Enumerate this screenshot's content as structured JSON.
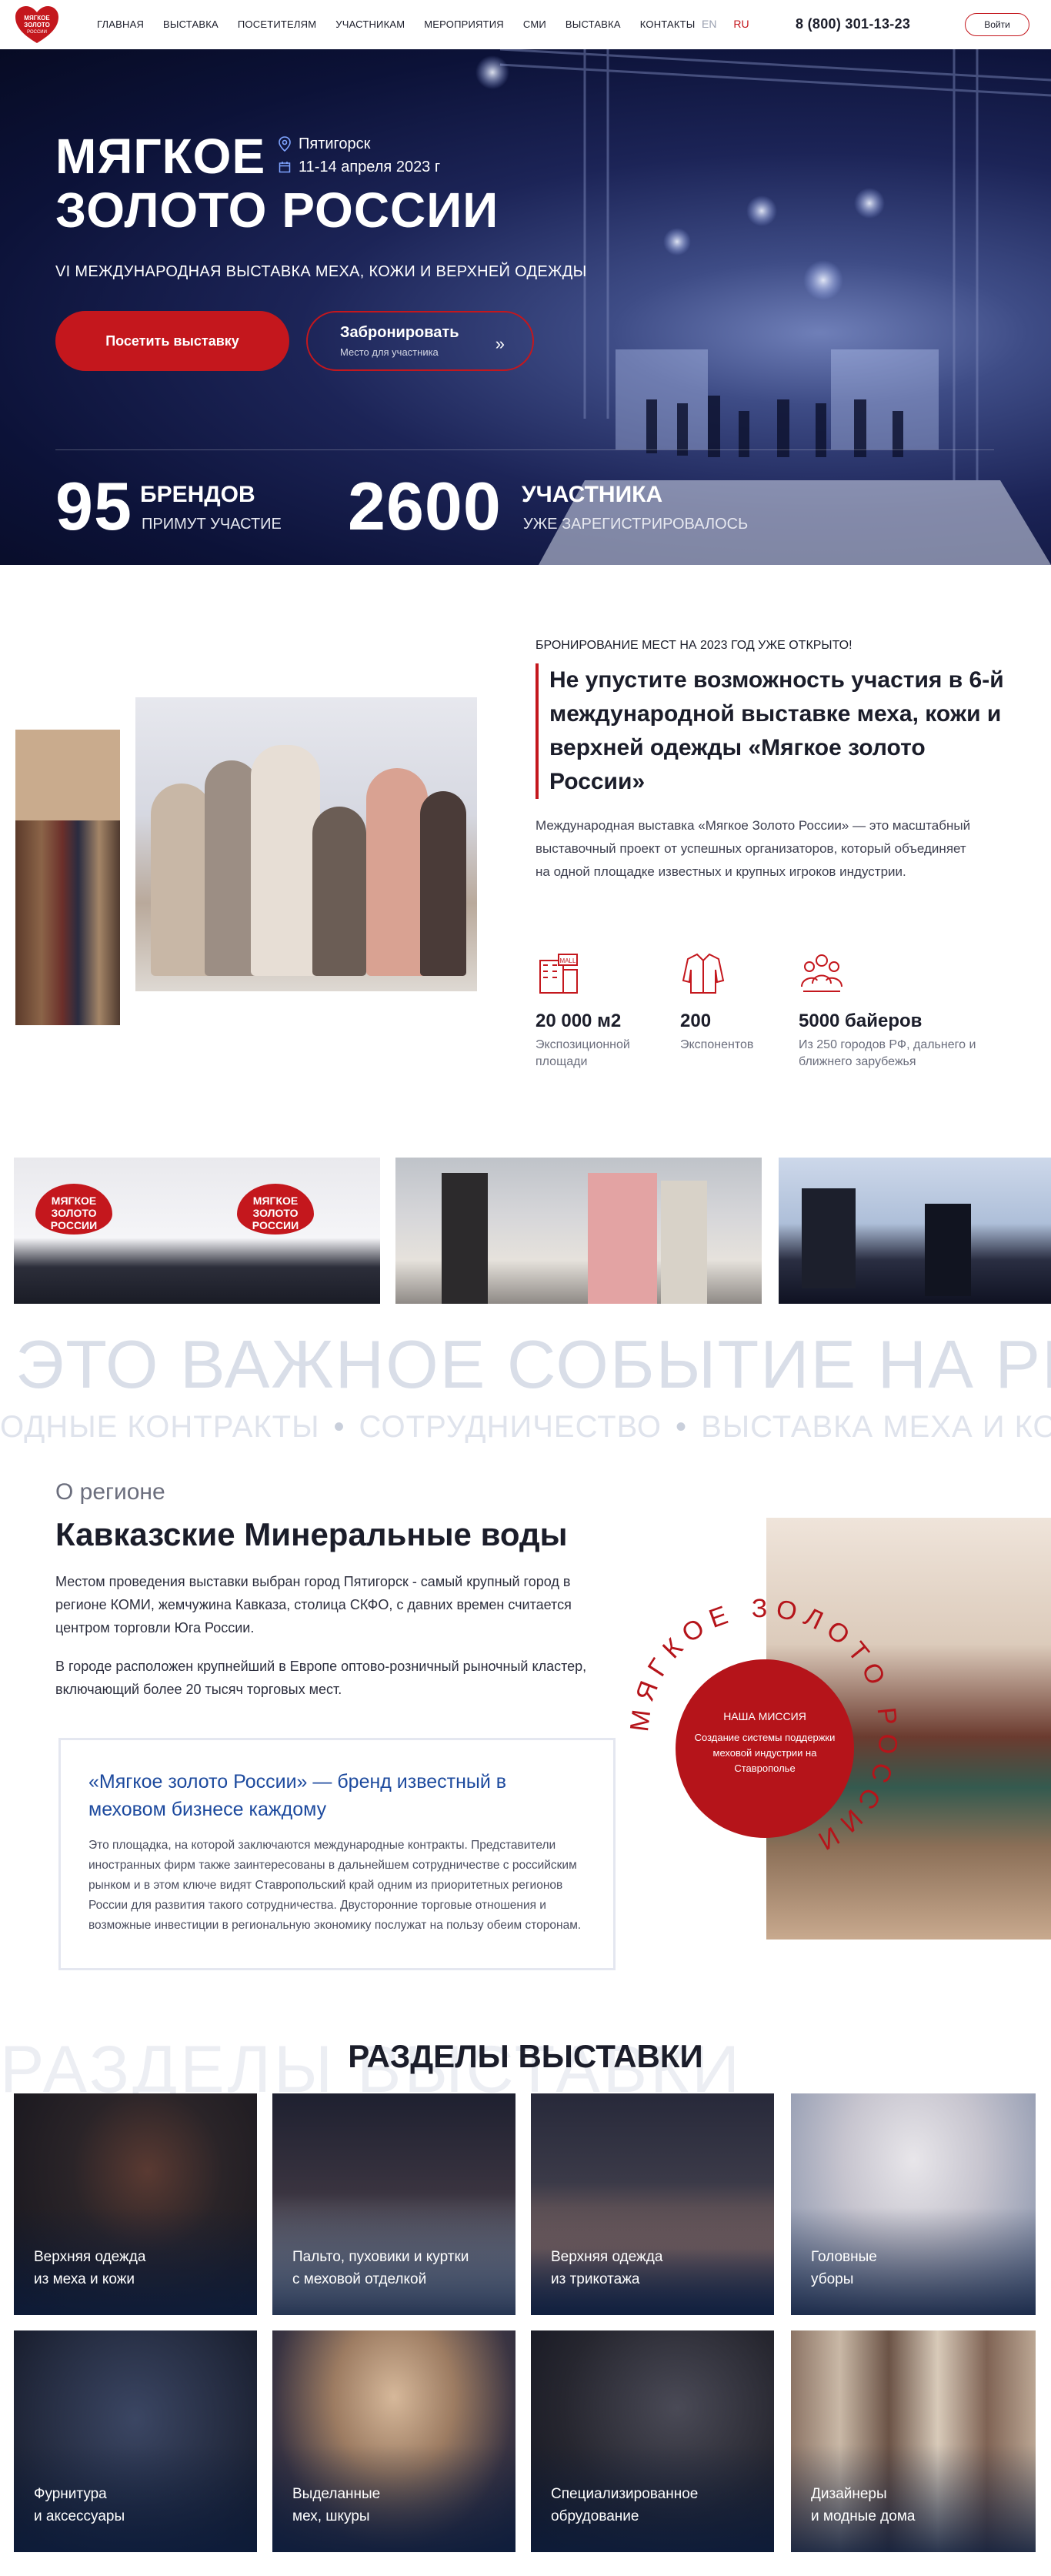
{
  "header": {
    "logo_text": "МЯГКОЕ ЗОЛОТО РОССИИ",
    "nav": [
      "ГЛАВНАЯ",
      "ВЫСТАВКА",
      "ПОСЕТИТЕЛЯМ",
      "УЧАСТНИКАМ",
      "МЕРОПРИЯТИЯ",
      "СМИ",
      "ВЫСТАВКА",
      "КОНТАКТЫ"
    ],
    "lang_en": "EN",
    "lang_ru": "RU",
    "phone": "8 (800) 301-13-23",
    "login": "Войти"
  },
  "hero": {
    "title_line1": "МЯГКОЕ",
    "title_line2": "ЗОЛОТО РОССИИ",
    "city": "Пятигорск",
    "dates": "11-14 апреля 2023 г",
    "subtitle": "VI МЕЖДУНАРОДНАЯ ВЫСТАВКА МЕХА, КОЖИ И ВЕРХНЕЙ ОДЕЖДЫ",
    "btn_visit": "Посетить выставку",
    "btn_book_title": "Забронировать",
    "btn_book_sub": "Место для участника",
    "stat1_num": "95",
    "stat1_l1": "БРЕНДОВ",
    "stat1_l2": "ПРИМУТ УЧАСТИЕ",
    "stat2_num": "2600",
    "stat2_l1": "УЧАСТНИКА",
    "stat2_l2": "УЖЕ ЗАРЕГИСТРИРОВАЛОСЬ"
  },
  "about": {
    "kicker": "БРОНИРОВАНИЕ МЕСТ НА 2023 ГОД УЖЕ ОТКРЫТО!",
    "title": "Не упустите возможность участия в 6-й международной выставке меха, кожи и верхней одежды «Мягкое золото России»",
    "text": "Международная выставка «Мягкое Золото России» — это масштабный выставочный проект от успешных организаторов, который объединяет на одной площадке известных и крупных игроков индустрии.",
    "features": [
      {
        "big": "20 000 м2",
        "small": "Экспозиционной площади",
        "icon": "mall-icon"
      },
      {
        "big": "200",
        "small": "Экспонентов",
        "icon": "coat-icon"
      },
      {
        "big": "5000 байеров",
        "small": "Из 250 городов РФ, дальнего и ближнего зарубежья",
        "icon": "people-icon"
      }
    ]
  },
  "gallery": {
    "heart_text": "МЯГКОЕ ЗОЛОТО РОССИИ"
  },
  "marquee": {
    "line1": "ЭТО ВАЖНОЕ СОБЫТИЕ НА РЫНКЕ",
    "line2_items": [
      "ОДНЫЕ КОНТРАКТЫ",
      "СОТРУДНИЧЕСТВО",
      "ВЫСТАВКА МЕХА И КОЖИ"
    ]
  },
  "region": {
    "kicker": "О регионе",
    "title": "Кавказские Минеральные воды",
    "p1": "Местом проведения выставки выбран город Пятигорск - самый крупный город в регионе КОМИ, жемчужина Кавказа, столица СКФО, с давних времен считается центром торговли Юга России.",
    "p2": "В городе расположен крупнейший в Европе оптово-розничный рыночный кластер, включающий более 20 тысяч торговых мест.",
    "box_title": "«Мягкое золото России» — бренд известный в меховом бизнесе каждому",
    "box_text": "Это площадка, на которой заключаются международные контракты. Представители иностранных фирм также заинтересованы в дальнейшем сотрудничестве с российским рынком и в этом ключе видят Ставропольский край одним из приоритетных регионов России для развития такого сотрудничества. Двусторонние торговые отношения и возможные инвестиции в региональную экономику послужат на пользу обеим сторонам.",
    "mission_kicker": "НАША МИССИЯ",
    "mission_text": "Создание системы поддержки меховой индустрии на Ставрополье",
    "ring_text": "МЯГКОЕ ЗОЛОТО РОССИИ"
  },
  "sections": {
    "bg_text": "РАЗДЕЛЫ ВЫСТАВКИ",
    "title": "РАЗДЕЛЫ ВЫСТАВКИ",
    "cards": [
      {
        "l1": "Верхняя одежда",
        "l2": "из меха и кожи"
      },
      {
        "l1": "Пальто, пуховики и куртки",
        "l2": "с меховой отделкой"
      },
      {
        "l1": "Верхняя одежда",
        "l2": "из трикотажа"
      },
      {
        "l1": "Головные",
        "l2": "уборы"
      },
      {
        "l1": "Фурнитура",
        "l2": "и аксессуары"
      },
      {
        "l1": "Выделанные",
        "l2": "мех, шкуры"
      },
      {
        "l1": "Специализированное",
        "l2": "обрудование"
      },
      {
        "l1": "Дизайнеры",
        "l2": "и модные дома"
      }
    ]
  }
}
